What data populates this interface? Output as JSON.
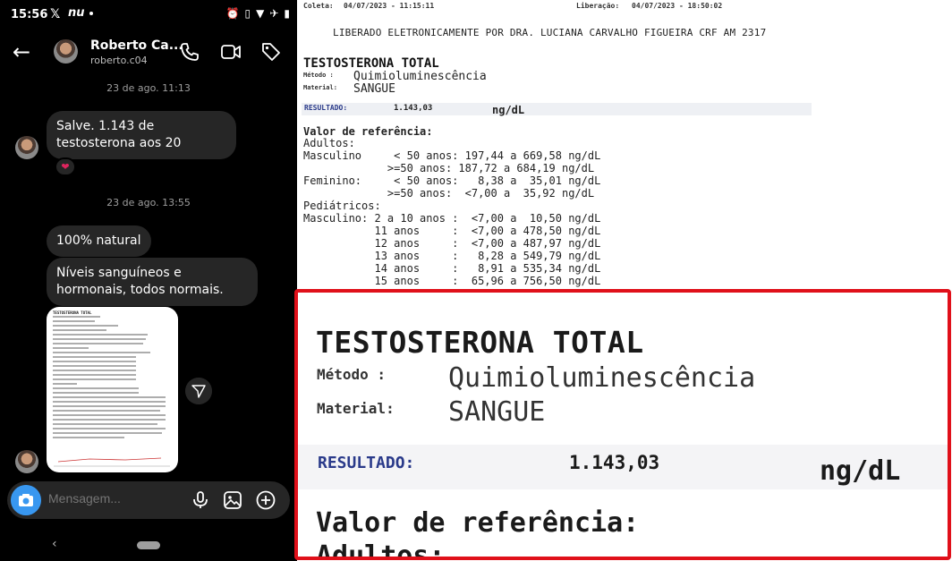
{
  "status_bar": {
    "time": "15:56",
    "x_icon": "𝕏",
    "carrier": "nu"
  },
  "header": {
    "name": "Roberto Ca...",
    "username": "roberto.c04"
  },
  "chat": {
    "timestamp_1": "23 de ago. 11:13",
    "msg_1": "Salve. 1.143 de testosterona aos 20",
    "reaction": "❤",
    "timestamp_2": "23 de ago. 13:55",
    "msg_2": "100% natural",
    "msg_3": "Níveis sanguíneos e hormonais, todos normais.",
    "thumb_title": "TESTOSTERONA TOTAL"
  },
  "composer": {
    "placeholder": "Mensagem..."
  },
  "document": {
    "coleta_label": "Coleta:",
    "coleta_value": "04/07/2023 - 11:15:11",
    "liberacao_label": "Liberação:",
    "liberacao_value": "04/07/2023 - 18:50:02",
    "liberado_text": "LIBERADO ELETRONICAMENTE POR DRA. LUCIANA CARVALHO FIGUEIRA CRF AM 2317",
    "title": "TESTOSTERONA TOTAL",
    "metodo_label": "Método  :",
    "metodo_value": "Quimioluminescência",
    "material_label": "Material:",
    "material_value": "SANGUE",
    "resultado_label": "RESULTADO:",
    "resultado_value": "1.143,03",
    "resultado_unit": "ng/dL",
    "ref_title": "Valor de referência:",
    "ref_lines": [
      "Adultos:",
      "Masculino     < 50 anos: 197,44 a 669,58 ng/dL",
      "             >=50 anos: 187,72 a 684,19 ng/dL",
      "Feminino:     < 50 anos:   8,38 a  35,01 ng/dL",
      "             >=50 anos:  <7,00 a  35,92 ng/dL",
      "Pediátricos:",
      "Masculino: 2 a 10 anos :  <7,00 a  10,50 ng/dL",
      "           11 anos     :  <7,00 a 478,50 ng/dL",
      "           12 anos     :  <7,00 a 487,97 ng/dL",
      "           13 anos     :   8,28 a 549,79 ng/dL",
      "           14 anos     :   8,91 a 535,34 ng/dL",
      "           15 anos     :  65,96 a 756,50 ng/dL"
    ]
  },
  "zoom": {
    "title": "TESTOSTERONA TOTAL",
    "metodo_label": "Método  :",
    "metodo_value": "Quimioluminescência",
    "material_label": "Material:",
    "material_value": "SANGUE",
    "resultado_label": "RESULTADO:",
    "resultado_value": "1.143,03",
    "resultado_unit": "ng/dL",
    "ref_title": "Valor de referência:",
    "adultos": "Adultos:"
  },
  "colors": {
    "highlight_border": "#e0101a",
    "result_label": "#2a3a8a",
    "camera_button": "#3897f0"
  }
}
